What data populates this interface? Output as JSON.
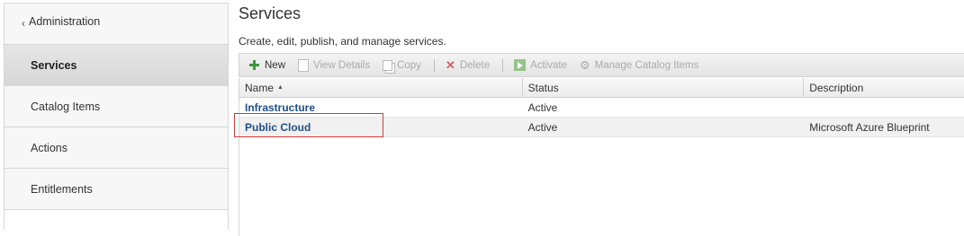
{
  "sidebar": {
    "back_label": "Administration",
    "items": [
      {
        "label": "Services"
      },
      {
        "label": "Catalog Items"
      },
      {
        "label": "Actions"
      },
      {
        "label": "Entitlements"
      }
    ]
  },
  "page": {
    "title": "Services",
    "subtitle": "Create, edit, publish, and manage services."
  },
  "toolbar": {
    "new": "New",
    "view_details": "View Details",
    "copy": "Copy",
    "delete": "Delete",
    "activate": "Activate",
    "manage_catalog_items": "Manage Catalog Items"
  },
  "grid": {
    "columns": [
      "Name",
      "Status",
      "Description"
    ],
    "rows": [
      {
        "name": "Infrastructure",
        "status": "Active",
        "description": ""
      },
      {
        "name": "Public Cloud",
        "status": "Active",
        "description": "Microsoft Azure Blueprint"
      }
    ]
  },
  "colors": {
    "link": "#1f4f8a",
    "highlight_box": "#d23b3b",
    "new_icon": "#3a9a3a"
  }
}
